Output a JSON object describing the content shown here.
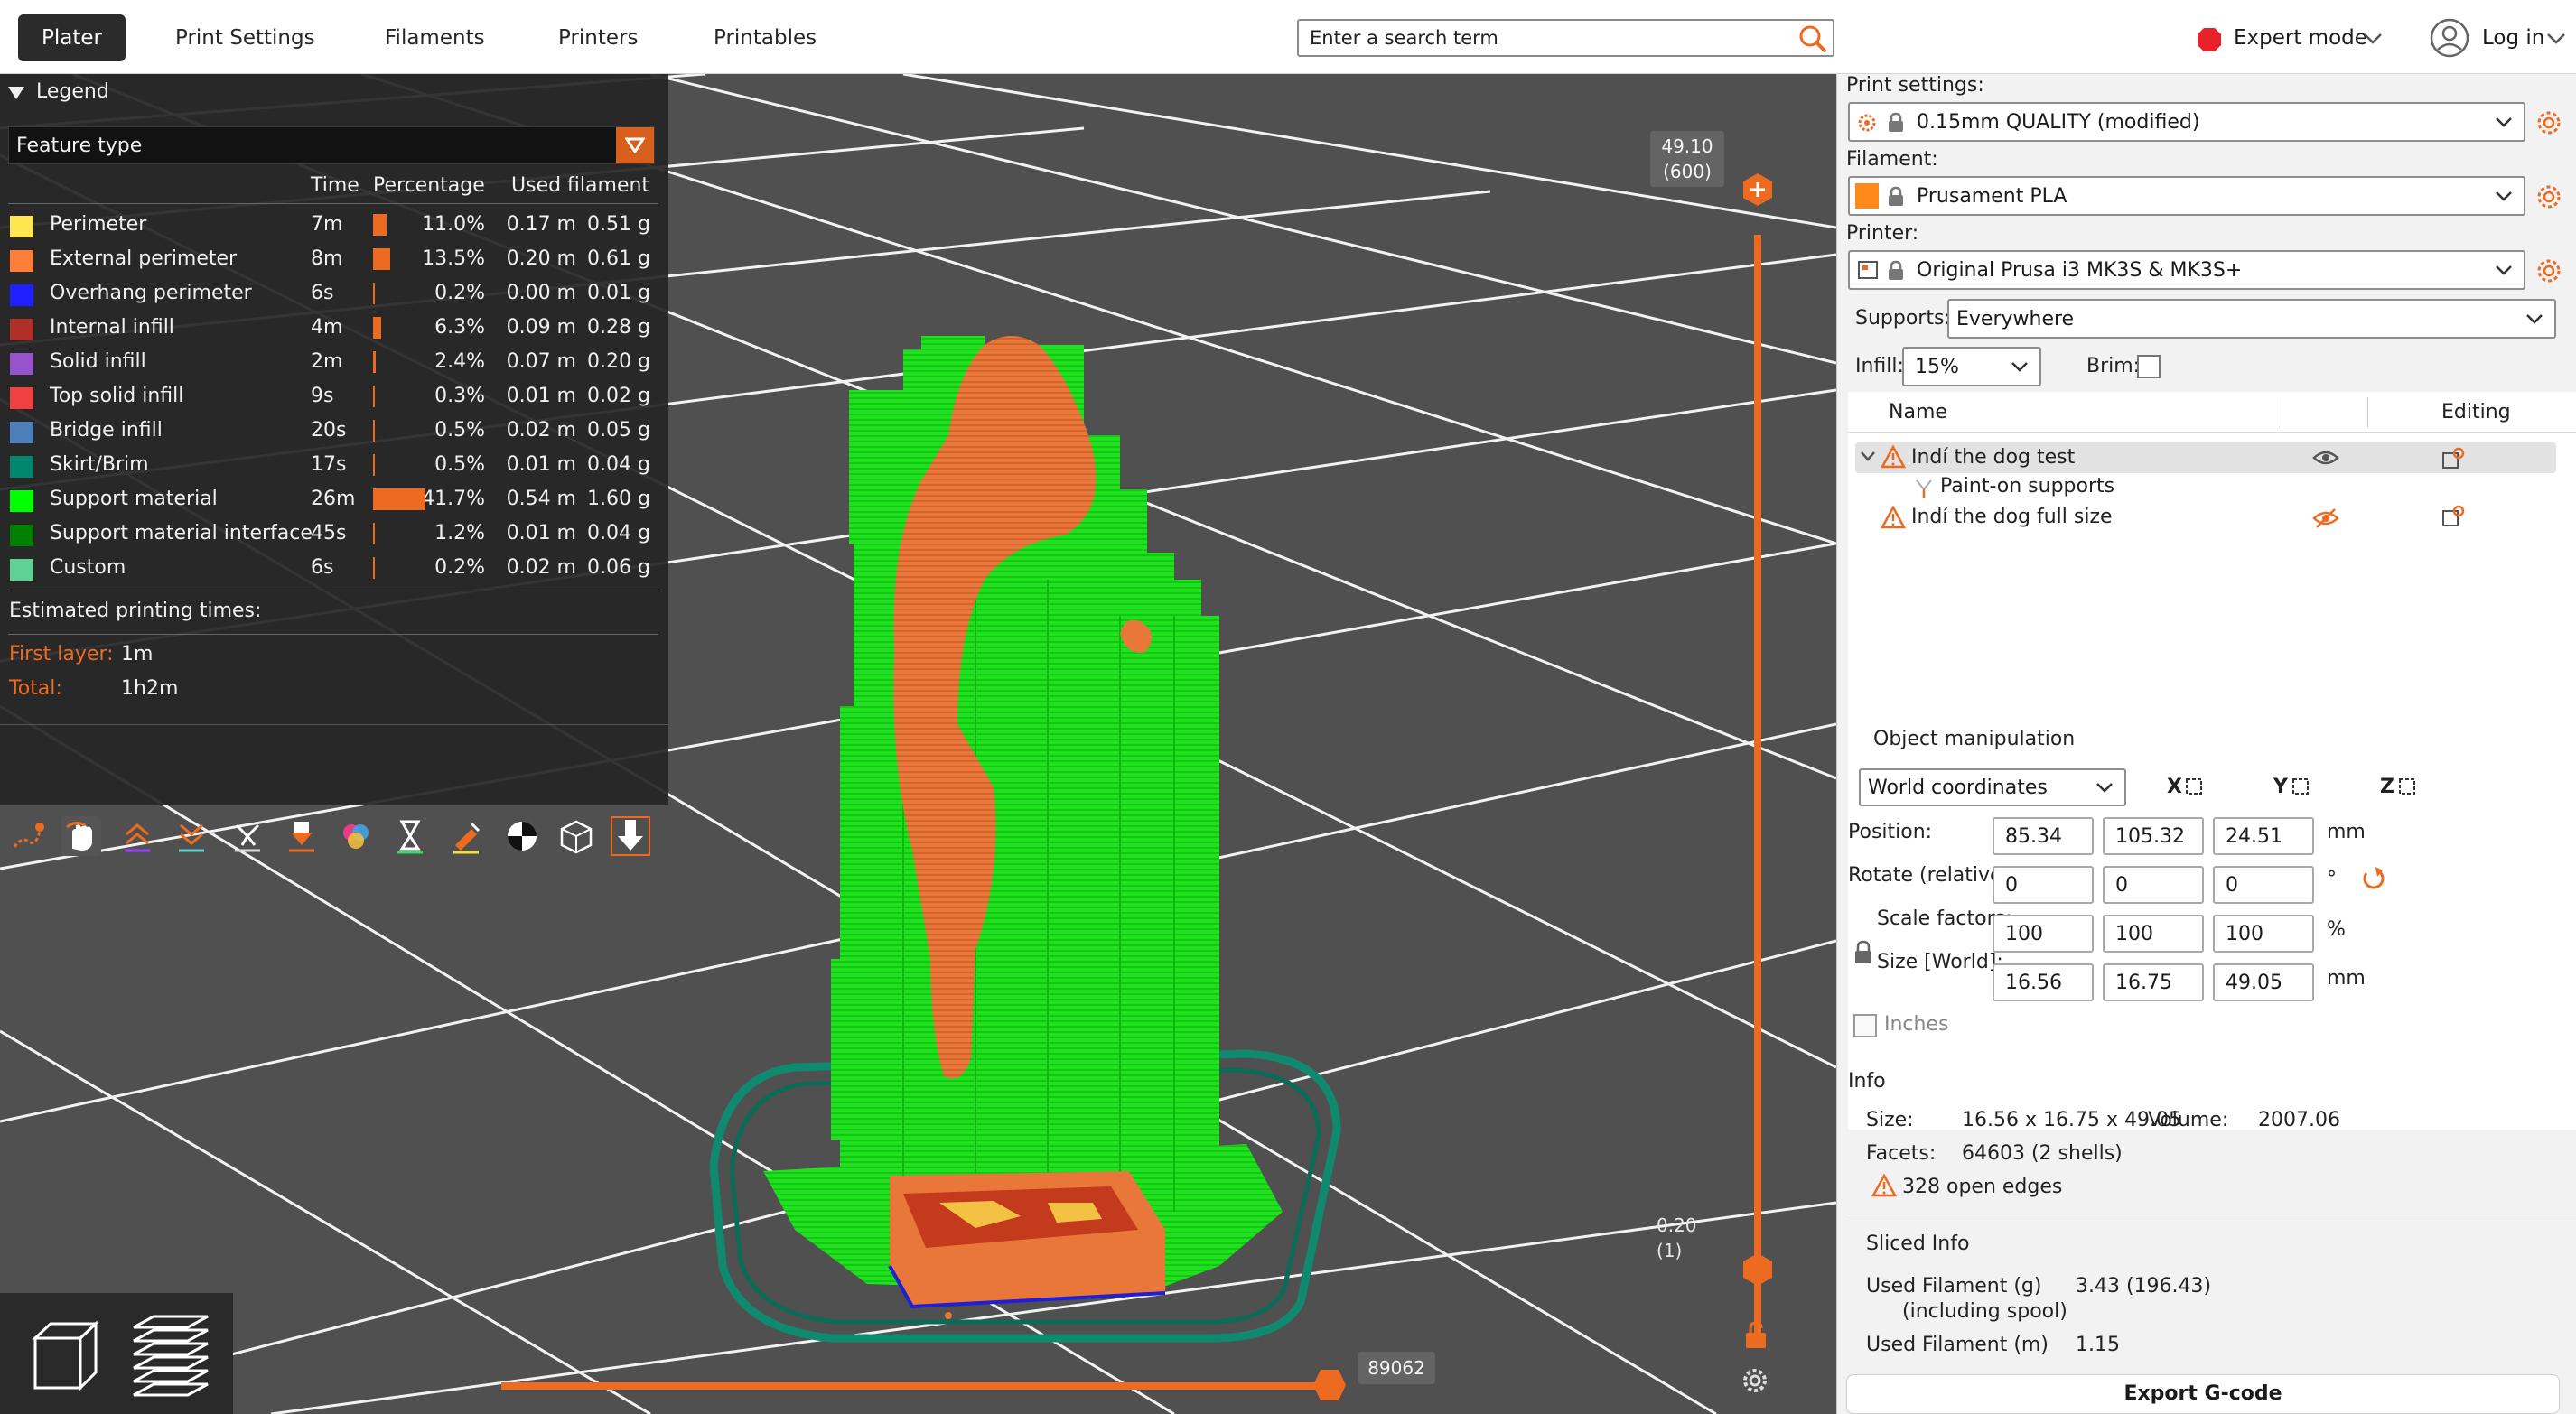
{
  "tabs": [
    "Plater",
    "Print Settings",
    "Filaments",
    "Printers",
    "Printables"
  ],
  "search": {
    "placeholder": "Enter a search term"
  },
  "mode": {
    "label": "Expert mode"
  },
  "login": {
    "label": "Log in"
  },
  "legend": {
    "title": "Legend",
    "view_type": "Feature type",
    "columns": {
      "time": "Time",
      "percentage": "Percentage",
      "used": "Used filament"
    },
    "rows": [
      {
        "name": "Perimeter",
        "color": "#ffe54f",
        "time": "7m",
        "pct": "11.0%",
        "pct_value": 11.0,
        "len": "0.17 m",
        "weight": "0.51 g"
      },
      {
        "name": "External perimeter",
        "color": "#ff7e39",
        "time": "8m",
        "pct": "13.5%",
        "pct_value": 13.5,
        "len": "0.20 m",
        "weight": "0.61 g"
      },
      {
        "name": "Overhang perimeter",
        "color": "#1f1fff",
        "time": "6s",
        "pct": "0.2%",
        "pct_value": 0.2,
        "len": "0.00 m",
        "weight": "0.01 g"
      },
      {
        "name": "Internal infill",
        "color": "#b03029",
        "time": "4m",
        "pct": "6.3%",
        "pct_value": 6.3,
        "len": "0.09 m",
        "weight": "0.28 g"
      },
      {
        "name": "Solid infill",
        "color": "#9654cc",
        "time": "2m",
        "pct": "2.4%",
        "pct_value": 2.4,
        "len": "0.07 m",
        "weight": "0.20 g"
      },
      {
        "name": "Top solid infill",
        "color": "#f04040",
        "time": "9s",
        "pct": "0.3%",
        "pct_value": 0.3,
        "len": "0.01 m",
        "weight": "0.02 g"
      },
      {
        "name": "Bridge infill",
        "color": "#4d80ba",
        "time": "20s",
        "pct": "0.5%",
        "pct_value": 0.5,
        "len": "0.02 m",
        "weight": "0.05 g"
      },
      {
        "name": "Skirt/Brim",
        "color": "#00876e",
        "time": "17s",
        "pct": "0.5%",
        "pct_value": 0.5,
        "len": "0.01 m",
        "weight": "0.04 g"
      },
      {
        "name": "Support material",
        "color": "#00ff00",
        "time": "26m",
        "pct": "41.7%",
        "pct_value": 41.7,
        "len": "0.54 m",
        "weight": "1.60 g"
      },
      {
        "name": "Support material interface",
        "color": "#008000",
        "time": "45s",
        "pct": "1.2%",
        "pct_value": 1.2,
        "len": "0.01 m",
        "weight": "0.04 g"
      },
      {
        "name": "Custom",
        "color": "#5ed194",
        "time": "6s",
        "pct": "0.2%",
        "pct_value": 0.2,
        "len": "0.02 m",
        "weight": "0.06 g"
      }
    ],
    "estimated_label": "Estimated printing times:",
    "first_layer_label": "First layer:",
    "first_layer_value": "1m",
    "total_label": "Total:",
    "total_value": "1h2m"
  },
  "slider_v": {
    "top_value": "49.10",
    "top_layer": "(600)",
    "bottom_value": "0.20",
    "bottom_layer": "(1)"
  },
  "slider_h": {
    "value": "89062"
  },
  "right": {
    "print_settings_label": "Print settings:",
    "print_settings_value": "0.15mm QUALITY (modified)",
    "filament_label": "Filament:",
    "filament_value": "Prusament PLA",
    "filament_color": "#ff8a1c",
    "printer_label": "Printer:",
    "printer_value": "Original Prusa i3 MK3S & MK3S+",
    "supports_label": "Supports:",
    "supports_value": "Everywhere",
    "infill_label": "Infill:",
    "infill_value": "15%",
    "brim_label": "Brim:",
    "objects": {
      "name_header": "Name",
      "editing_header": "Editing",
      "items": [
        "Indí the dog test",
        "Paint-on supports",
        "Indí the dog full size"
      ]
    },
    "manip": {
      "title": "Object manipulation",
      "coord_system": "World coordinates",
      "axes": [
        "X",
        "Y",
        "Z"
      ],
      "position_label": "Position:",
      "position": [
        "85.34",
        "105.32",
        "24.51"
      ],
      "position_unit": "mm",
      "rotate_label": "Rotate (relative):",
      "rotate": [
        "0",
        "0",
        "0"
      ],
      "rotate_unit": "°",
      "scale_label": "Scale factors:",
      "scale": [
        "100",
        "100",
        "100"
      ],
      "scale_unit": "%",
      "size_label": "Size [World]:",
      "size": [
        "16.56",
        "16.75",
        "49.05"
      ],
      "size_unit": "mm",
      "inches_label": "Inches"
    },
    "info": {
      "title": "Info",
      "size_label": "Size:",
      "size_value": "16.56 x 16.75 x 49.05",
      "volume_label": "Volume:",
      "volume_value": "2007.06",
      "facets_label": "Facets:",
      "facets_value": "64603 (2 shells)",
      "open_edges": "328 open edges"
    },
    "sliced": {
      "title": "Sliced Info",
      "used_g_label": "Used Filament (g)",
      "used_g_sub": "(including spool)",
      "used_g_value": "3.43 (196.43)",
      "used_m_label": "Used Filament (m)",
      "used_m_value": "1.15"
    },
    "export_label": "Export G-code"
  }
}
